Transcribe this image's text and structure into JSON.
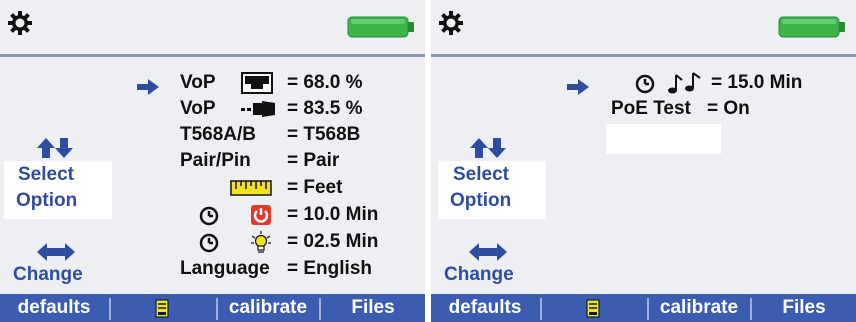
{
  "colors": {
    "panel_bg": "#eeeff2",
    "accent_blue": "#2f4da0",
    "footer_blue": "#3b5cb0",
    "battery_green": "#3cb54a",
    "power_red": "#e33a2c",
    "ruler_yellow": "#f1e220"
  },
  "left": {
    "icons": [
      "gear-icon",
      "battery-full-icon"
    ],
    "rows": [
      {
        "label": "VoP",
        "value": "= 68.0 %",
        "icon": "ethernet-port-icon"
      },
      {
        "label": "VoP",
        "value": "= 83.5 %",
        "icon": "cable-plug-icon"
      },
      {
        "label": "T568A/B",
        "value": "= T568B"
      },
      {
        "label": "Pair/Pin",
        "value": "= Pair"
      },
      {
        "label": "",
        "value": "= Feet",
        "icon": "ruler-icon"
      },
      {
        "label": "",
        "value": "= 10.0 Min",
        "icon": "power-icon"
      },
      {
        "label": "",
        "value": "= 02.5 Min",
        "icon": "backlight-bulb-icon"
      },
      {
        "label": "Language",
        "value": "= English"
      }
    ],
    "side": {
      "select": "Select",
      "option": "Option",
      "change": "Change"
    },
    "footer": {
      "defaults": "defaults",
      "calibrate": "calibrate",
      "files": "Files"
    }
  },
  "right": {
    "icons": [
      "gear-icon",
      "battery-full-icon"
    ],
    "rows": [
      {
        "label": "",
        "value": "= 15.0 Min",
        "icon": "music-note-icon"
      },
      {
        "label": "PoE Test",
        "value": "= On"
      }
    ],
    "side": {
      "select": "Select",
      "option": "Option",
      "change": "Change"
    },
    "footer": {
      "defaults": "defaults",
      "calibrate": "calibrate",
      "files": "Files"
    }
  }
}
